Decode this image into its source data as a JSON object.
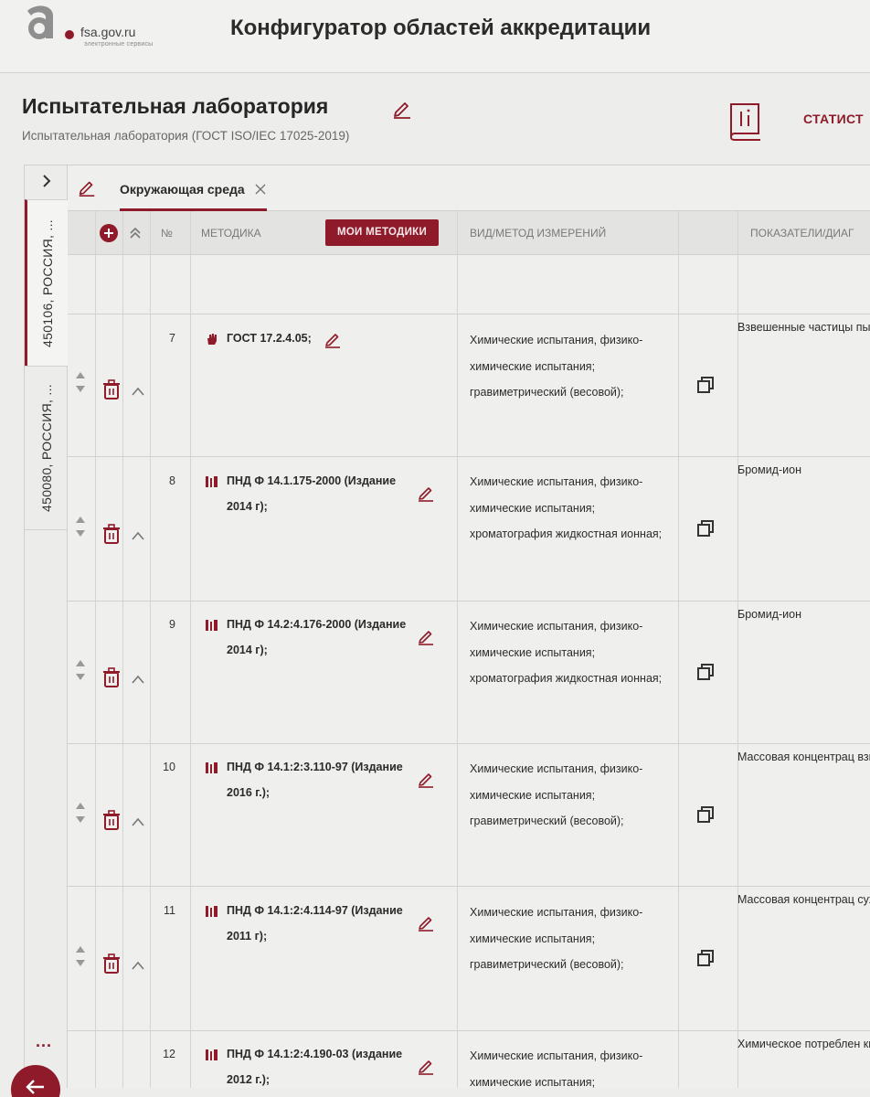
{
  "header": {
    "logo_text": "fsa.gov.ru",
    "logo_sub": "электронные сервисы",
    "app_title": "Конфигуратор областей аккредитации"
  },
  "lab": {
    "title": "Испытательная лаборатория",
    "subtitle": "Испытательная лаборатория (ГОСТ ISO/IEC 17025-2019)",
    "stats_link": "СТАТИСТ"
  },
  "sidebar": {
    "tabs": [
      {
        "label": "450106, РОССИЯ, ..."
      },
      {
        "label": "450080, РОССИЯ, ..."
      }
    ],
    "more": "..."
  },
  "tabs": [
    {
      "label": "Окружающая среда"
    }
  ],
  "table": {
    "headers": {
      "num": "№",
      "method": "МЕТОДИКА",
      "my_methods": "МОИ МЕТОДИКИ",
      "measure": "ВИД/МЕТОД ИЗМЕРЕНИЙ",
      "indicators": "ПОКАЗАТЕЛИ/ДИАГ"
    },
    "rows": [
      {
        "num": "7",
        "icon": "hand-icon",
        "method": "ГОСТ 17.2.4.05;",
        "measure": "Химические испытания, физико-химические испытания; гравиметрический (весовой);",
        "indicator": "Взвешенные частицы пыли"
      },
      {
        "num": "8",
        "icon": "doc-bars-icon",
        "method": "ПНД Ф 14.1.175-2000 (Издание 2014 г);",
        "measure": "Химические испытания, физико-химические испытания; хроматография жидкостная ионная;",
        "indicator": "Бромид-ион"
      },
      {
        "num": "9",
        "icon": "doc-bars-icon",
        "method": "ПНД Ф 14.2:4.176-2000 (Издание 2014 г);",
        "measure": "Химические испытания, физико-химические испытания; хроматография жидкостная ионная;",
        "indicator": "Бромид-ион"
      },
      {
        "num": "10",
        "icon": "doc-bars-icon",
        "method": "ПНД Ф 14.1:2:3.110-97 (Издание 2016 г.);",
        "measure": "Химические испытания, физико-химические испытания; гравиметрический (весовой);",
        "indicator": "Массовая концентрац взвешенных веществ"
      },
      {
        "num": "11",
        "icon": "doc-bars-icon",
        "method": "ПНД Ф 14.1:2:4.114-97 (Издание 2011 г);",
        "measure": "Химические испытания, физико-химические испытания; гравиметрический (весовой);",
        "indicator": "Массовая концентрац сухого остатка"
      },
      {
        "num": "12",
        "icon": "doc-bars-icon",
        "method": "ПНД Ф 14.1:2:4.190-03 (издание 2012 г.);",
        "measure": "Химические испытания, физико-химические испытания;",
        "indicator": "Химическое потреблен кислорода (ХПК)"
      }
    ]
  },
  "colors": {
    "accent": "#8f1b2a",
    "background": "#ededeb",
    "header_bg": "#e3e3e1"
  }
}
